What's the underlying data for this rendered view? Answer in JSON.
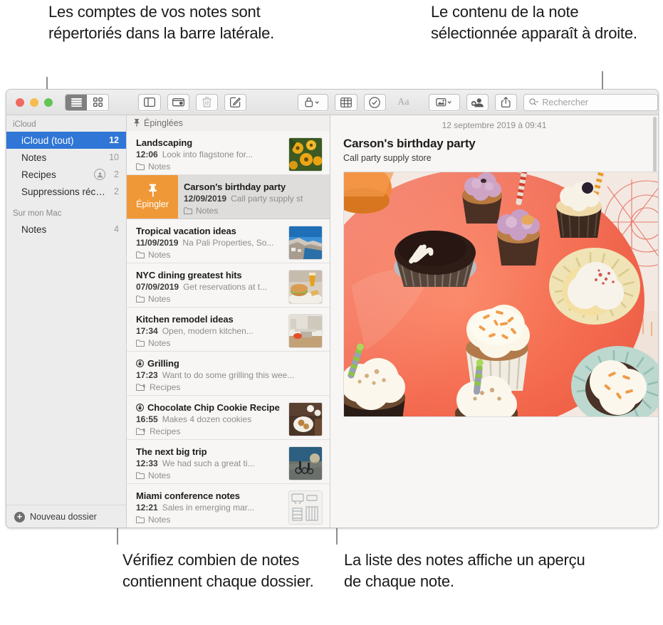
{
  "callouts": {
    "top_left": "Les comptes de vos notes sont répertoriés dans la barre latérale.",
    "top_right": "Le contenu de la note sélectionnée apparaît à droite.",
    "bottom_left": "Vérifiez combien de notes contiennent chaque dossier.",
    "bottom_right": "La liste des notes affiche un aperçu de chaque note."
  },
  "toolbar": {
    "view_list_icon": "list-view-icon",
    "view_grid_icon": "grid-view-icon",
    "sidebar_toggle_icon": "sidebar-toggle-icon",
    "folders_icon": "folders-icon",
    "delete_icon": "trash-icon",
    "compose_icon": "compose-note-icon",
    "lock_icon": "lock-icon",
    "table_icon": "table-icon",
    "checklist_icon": "checklist-icon",
    "format_icon": "format-text-icon",
    "media_icon": "media-icon",
    "share_collab_icon": "add-collaborator-icon",
    "share_icon": "share-icon",
    "search_placeholder": "Rechercher"
  },
  "sidebar": {
    "sections": [
      {
        "title": "iCloud",
        "items": [
          {
            "label": "iCloud (tout)",
            "count": "12",
            "selected": true,
            "shared": false
          },
          {
            "label": "Notes",
            "count": "10",
            "selected": false,
            "shared": false
          },
          {
            "label": "Recipes",
            "count": "2",
            "selected": false,
            "shared": true
          },
          {
            "label": "Suppressions récent...",
            "count": "2",
            "selected": false,
            "shared": false
          }
        ]
      },
      {
        "title": "Sur mon Mac",
        "items": [
          {
            "label": "Notes",
            "count": "4",
            "selected": false,
            "shared": false
          }
        ]
      }
    ],
    "new_folder_label": "Nouveau dossier"
  },
  "list": {
    "pinned_header": "Épinglées",
    "swipe_action_label": "Épingler",
    "notes": [
      {
        "title": "Landscaping",
        "when": "12:06",
        "preview": "Look into flagstone for...",
        "folder": "Notes",
        "thumb": "flowers",
        "locked": false,
        "shared_folder": false,
        "selected": false
      },
      {
        "title": "Carson's birthday party",
        "when": "12/09/2019",
        "preview": "Call party supply st",
        "folder": "Notes",
        "thumb": "none",
        "locked": false,
        "shared_folder": false,
        "selected": true
      },
      {
        "title": "Tropical vacation ideas",
        "when": "11/09/2019",
        "preview": "Na Pali Properties, So...",
        "folder": "Notes",
        "thumb": "coast",
        "locked": false,
        "shared_folder": false,
        "selected": false
      },
      {
        "title": "NYC dining greatest hits",
        "when": "07/09/2019",
        "preview": "Get reservations at t...",
        "folder": "Notes",
        "thumb": "burger",
        "locked": false,
        "shared_folder": false,
        "selected": false
      },
      {
        "title": "Kitchen remodel ideas",
        "when": "17:34",
        "preview": "Open, modern kitchen...",
        "folder": "Notes",
        "thumb": "kitchen",
        "locked": false,
        "shared_folder": false,
        "selected": false
      },
      {
        "title": "Grilling",
        "when": "17:23",
        "preview": "Want to do some grilling this wee...",
        "folder": "Recipes",
        "thumb": "none",
        "locked": true,
        "shared_folder": true,
        "selected": false
      },
      {
        "title": "Chocolate Chip Cookie Recipe",
        "when": "16:55",
        "preview": "Makes 4 dozen cookies",
        "folder": "Recipes",
        "thumb": "cookies",
        "locked": true,
        "shared_folder": true,
        "selected": false
      },
      {
        "title": "The next big trip",
        "when": "12:33",
        "preview": "We had such a great ti...",
        "folder": "Notes",
        "thumb": "bikes",
        "locked": false,
        "shared_folder": false,
        "selected": false
      },
      {
        "title": "Miami conference notes",
        "when": "12:21",
        "preview": "Sales in emerging mar...",
        "folder": "Notes",
        "thumb": "sketch",
        "locked": false,
        "shared_folder": false,
        "selected": false
      }
    ]
  },
  "detail": {
    "date": "12 septembre 2019 à 09:41",
    "title": "Carson's birthday party",
    "body": "Call party supply store",
    "attachment_alt": "cupcakes-on-orange-plate-photo"
  },
  "colors": {
    "selection_blue": "#2f76d6",
    "swipe_orange": "#ef9838",
    "sidebar_bg": "#ececec",
    "list_bg": "#f7f6f5"
  }
}
